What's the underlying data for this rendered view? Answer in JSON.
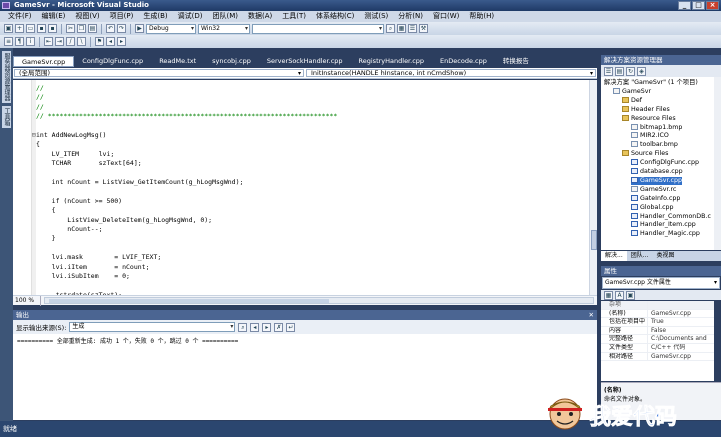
{
  "window": {
    "title": "GameSvr - Microsoft Visual Studio"
  },
  "menu": [
    "文件(F)",
    "编辑(E)",
    "视图(V)",
    "项目(P)",
    "生成(B)",
    "调试(D)",
    "团队(M)",
    "数据(A)",
    "工具(T)",
    "体系结构(C)",
    "测试(S)",
    "分析(N)",
    "窗口(W)",
    "帮助(H)"
  ],
  "toolbar": {
    "config": "Debug",
    "platform": "Win32",
    "search": ""
  },
  "left_strip": [
    "服务器资源管理器",
    "工具箱"
  ],
  "doc_tabs": [
    "GameSvr.cpp",
    "ConfigDlgFunc.cpp",
    "ReadMe.txt",
    "syncobj.cpp",
    "ServerSockHandler.cpp",
    "RegistryHandler.cpp",
    "EnDecode.cpp",
    "转换报告"
  ],
  "nav": {
    "scope": "(全局范围)",
    "member": "InitInstance(HANDLE hInstance, int nCmdShow)"
  },
  "code": [
    {
      "t": "//",
      "c": "cm"
    },
    {
      "t": "//",
      "c": "cm"
    },
    {
      "t": "//",
      "c": "cm"
    },
    {
      "t": "// **************************************************************************",
      "c": "cm"
    },
    {
      "t": "",
      "c": ""
    },
    {
      "t": "int AddNewLogMsg()",
      "c": ""
    },
    {
      "t": "{",
      "c": ""
    },
    {
      "t": "    LV_ITEM     lvi;",
      "c": ""
    },
    {
      "t": "    TCHAR       szText[64];",
      "c": ""
    },
    {
      "t": "",
      "c": ""
    },
    {
      "t": "    int nCount = ListView_GetItemCount(g_hLogMsgWnd);",
      "c": ""
    },
    {
      "t": "",
      "c": ""
    },
    {
      "t": "    if (nCount >= 500)",
      "c": ""
    },
    {
      "t": "    {",
      "c": ""
    },
    {
      "t": "        ListView_DeleteItem(g_hLogMsgWnd, 0);",
      "c": ""
    },
    {
      "t": "        nCount--;",
      "c": ""
    },
    {
      "t": "    }",
      "c": ""
    },
    {
      "t": "",
      "c": ""
    },
    {
      "t": "    lvi.mask        = LVIF_TEXT;",
      "c": ""
    },
    {
      "t": "    lvi.iItem       = nCount;",
      "c": ""
    },
    {
      "t": "    lvi.iSubItem    = 0;",
      "c": ""
    },
    {
      "t": "",
      "c": ""
    },
    {
      "t": "    _tstrdate(szText);",
      "c": ""
    }
  ],
  "zoom": "100 %",
  "output": {
    "title": "输出",
    "source_label": "显示输出来源(S):",
    "source_value": "生成",
    "text": "========== 全部重新生成: 成功 1 个，失败 0 个，跳过 0 个 =========="
  },
  "solution": {
    "title": "解决方案资源管理器",
    "root": "解决方案 \"GameSvr\" (1 个项目)",
    "items": [
      {
        "label": "GameSvr",
        "type": "proj",
        "indent": 1
      },
      {
        "label": "Def",
        "type": "fold",
        "indent": 2
      },
      {
        "label": "Header Files",
        "type": "fold",
        "indent": 2
      },
      {
        "label": "Resource Files",
        "type": "fold",
        "indent": 2
      },
      {
        "label": "bitmap1.bmp",
        "type": "file",
        "indent": 3
      },
      {
        "label": "MIR2.ICO",
        "type": "file",
        "indent": 3
      },
      {
        "label": "toolbar.bmp",
        "type": "file",
        "indent": 3
      },
      {
        "label": "Source Files",
        "type": "fold",
        "indent": 2
      },
      {
        "label": "ConfigDlgFunc.cpp",
        "type": "cpp",
        "indent": 3
      },
      {
        "label": "database.cpp",
        "type": "cpp",
        "indent": 3
      },
      {
        "label": "GameSvr.cpp",
        "type": "cpp",
        "indent": 3,
        "selected": true
      },
      {
        "label": "GameSvr.rc",
        "type": "file",
        "indent": 3
      },
      {
        "label": "GateInfo.cpp",
        "type": "cpp",
        "indent": 3
      },
      {
        "label": "Global.cpp",
        "type": "cpp",
        "indent": 3
      },
      {
        "label": "Handler_CommonDB.c",
        "type": "cpp",
        "indent": 3
      },
      {
        "label": "Handler_Item.cpp",
        "type": "cpp",
        "indent": 3
      },
      {
        "label": "Handler_Magic.cpp",
        "type": "cpp",
        "indent": 3
      }
    ],
    "tabs": [
      "解决...",
      "团队...",
      "类视图"
    ]
  },
  "properties": {
    "title": "属性",
    "object": "GameSvr.cpp 文件属性",
    "rows": [
      {
        "k": "杂项",
        "v": "",
        "cat": true
      },
      {
        "k": "(名称)",
        "v": "GameSvr.cpp"
      },
      {
        "k": "包括在项目中",
        "v": "True"
      },
      {
        "k": "内容",
        "v": "False"
      },
      {
        "k": "完整路径",
        "v": "C:\\Documents and"
      },
      {
        "k": "文件类型",
        "v": "C/C++ 代码"
      },
      {
        "k": "相对路径",
        "v": "GameSvr.cpp"
      }
    ],
    "desc_title": "(名称)",
    "desc_text": "命名文件对象。"
  },
  "status": "就绪",
  "watermark": "我爱代码"
}
